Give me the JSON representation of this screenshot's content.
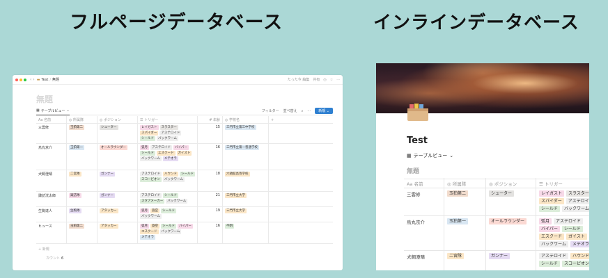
{
  "headings": {
    "full_page": "フルページデータベース",
    "inline": "インラインデータベース"
  },
  "colors": {
    "background": "#abd8d6",
    "accent": "#2f80d1"
  },
  "window": {
    "breadcrumb": [
      "Test",
      "無題"
    ],
    "toolbar_right": [
      "たった今 編集",
      "共有"
    ],
    "page_title": "無題",
    "view_tab": "テーブルビュー",
    "tools": {
      "filter": "フィルター",
      "sort": "並べ替え",
      "new": "新規"
    },
    "columns": [
      "Aa 名前",
      "所属隊",
      "ポジション",
      "トリガー",
      "年齢",
      "学校名",
      "+"
    ],
    "rows": [
      {
        "name": "三雲修",
        "unit": "玉狛第二",
        "position": "シューター",
        "triggers": [
          "レイガスト",
          "スラスター",
          "スパイダー",
          "アステロイド",
          "シールド",
          "バックワーム"
        ],
        "age": "15",
        "school": "三門市立第三中学校"
      },
      {
        "name": "烏丸京介",
        "unit": "玉狛第一",
        "position": "オールラウンダー",
        "triggers": [
          "弧月",
          "アステロイド",
          "バイパー",
          "シールド",
          "エスクード",
          "ガイスト",
          "バックワーム",
          "メテオラ"
        ],
        "age": "16",
        "school": "三門市立第一普通学校"
      },
      {
        "name": "犬飼澄晴",
        "unit": "二宮隊",
        "position": "ガンナー",
        "triggers": [
          "アステロイド",
          "ハウンド",
          "シールド",
          "スコーピオン",
          "バックワーム"
        ],
        "age": "18",
        "school": "六頴館高等学校"
      },
      {
        "name": "諏訪洸太郎",
        "unit": "諏訪隊",
        "position": "ガンナー",
        "triggers": [
          "アステロイド",
          "シールド",
          "スタアメーカー",
          "バックワーム"
        ],
        "age": "21",
        "school": "三門市立大学"
      },
      {
        "name": "生駒達人",
        "unit": "生駒隊",
        "position": "アタッカー",
        "triggers": [
          "弧月",
          "旋空",
          "シールド",
          "バックワーム"
        ],
        "age": "19",
        "school": "三門市立大学"
      },
      {
        "name": "ヒュース",
        "unit": "玉狛第二",
        "position": "アタッカー",
        "triggers": [
          "弧月",
          "旋空",
          "シールド",
          "バイパー",
          "エスクード",
          "バックワーム",
          "メテオラ"
        ],
        "age": "16",
        "school": "不明"
      }
    ],
    "add_row": "+ 新規",
    "count_label": "カウント",
    "count_value": "6"
  },
  "inline": {
    "title": "Test",
    "view_tab": "テーブルビュー",
    "sub_title": "無題",
    "columns": [
      "Aa 名前",
      "所属隊",
      "ポジション",
      "トリガー"
    ],
    "rows": [
      {
        "name": "三雲修",
        "unit": "玉狛第二",
        "position": "シューター",
        "triggers": [
          "レイガスト",
          "スラスター",
          "スパイダー",
          "アステロイド",
          "シールド",
          "バックワーム"
        ]
      },
      {
        "name": "烏丸京介",
        "unit": "玉狛第一",
        "position": "オールラウンダー",
        "triggers": [
          "弧月",
          "アステロイド",
          "バイパー",
          "シールド",
          "エスクード",
          "ガイスト",
          "バックワーム",
          "メテオラ"
        ]
      },
      {
        "name": "犬飼澄晴",
        "unit": "二宮隊",
        "position": "ガンナー",
        "triggers": [
          "アステロイド",
          "ハウンド",
          "シールド",
          "スコーピオン"
        ]
      }
    ]
  }
}
